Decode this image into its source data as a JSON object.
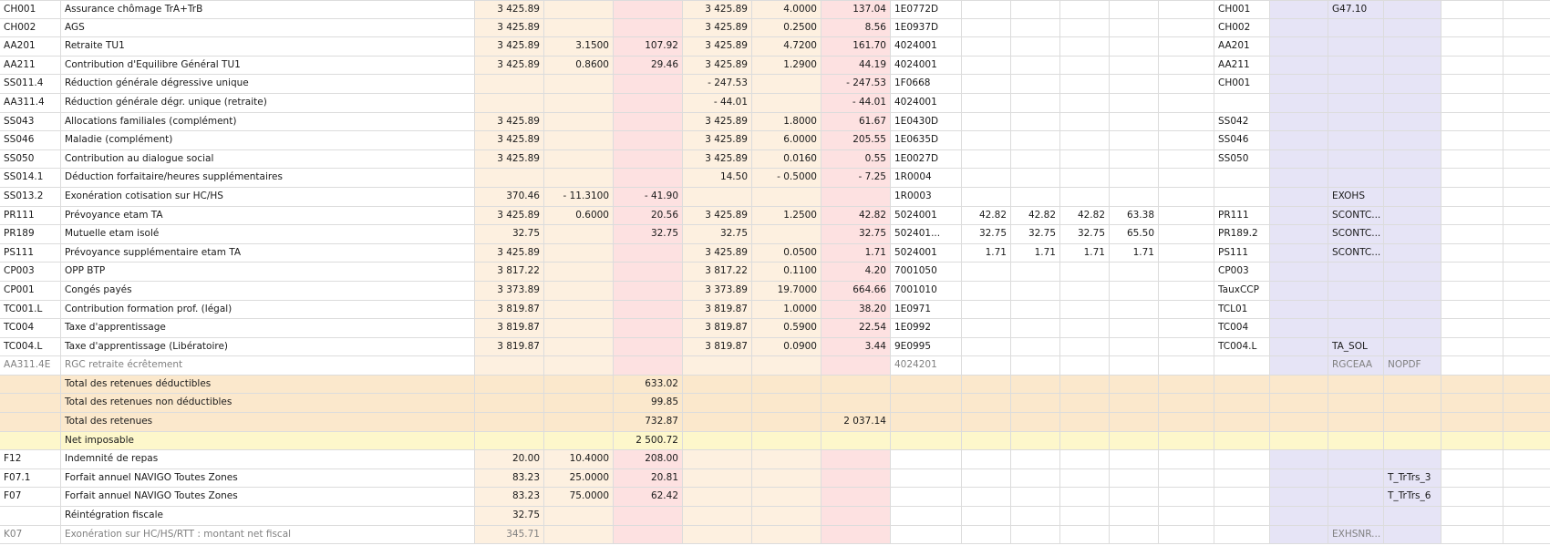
{
  "rows": [
    {
      "kind": "normal",
      "cells": [
        "CH001",
        "Assurance chômage TrA+TrB",
        "3 425.89",
        "",
        "",
        "3 425.89",
        "4.0000",
        "137.04",
        "1E0772D",
        "",
        "",
        "",
        "",
        "",
        "CH001",
        "",
        "G47.10",
        "",
        "",
        ""
      ]
    },
    {
      "kind": "normal",
      "cells": [
        "CH002",
        "AGS",
        "3 425.89",
        "",
        "",
        "3 425.89",
        "0.2500",
        "8.56",
        "1E0937D",
        "",
        "",
        "",
        "",
        "",
        "CH002",
        "",
        "",
        "",
        "",
        ""
      ]
    },
    {
      "kind": "normal",
      "cells": [
        "AA201",
        "Retraite TU1",
        "3 425.89",
        "3.1500",
        "107.92",
        "3 425.89",
        "4.7200",
        "161.70",
        "4024001",
        "",
        "",
        "",
        "",
        "",
        "AA201",
        "",
        "",
        "",
        "",
        ""
      ]
    },
    {
      "kind": "normal",
      "cells": [
        "AA211",
        "Contribution d'Equilibre Général TU1",
        "3 425.89",
        "0.8600",
        "29.46",
        "3 425.89",
        "1.2900",
        "44.19",
        "4024001",
        "",
        "",
        "",
        "",
        "",
        "AA211",
        "",
        "",
        "",
        "",
        ""
      ]
    },
    {
      "kind": "normal",
      "cells": [
        "SS011.4",
        "Réduction générale dégressive unique",
        "",
        "",
        "",
        "- 247.53",
        "",
        "- 247.53",
        "1F0668",
        "",
        "",
        "",
        "",
        "",
        "CH001",
        "",
        "",
        "",
        "",
        ""
      ]
    },
    {
      "kind": "normal",
      "cells": [
        "AA311.4",
        "Réduction générale dégr. unique (retraite)",
        "",
        "",
        "",
        "- 44.01",
        "",
        "- 44.01",
        "4024001",
        "",
        "",
        "",
        "",
        "",
        "",
        "",
        "",
        "",
        "",
        ""
      ]
    },
    {
      "kind": "normal",
      "cells": [
        "SS043",
        "Allocations familiales (complément)",
        "3 425.89",
        "",
        "",
        "3 425.89",
        "1.8000",
        "61.67",
        "1E0430D",
        "",
        "",
        "",
        "",
        "",
        "SS042",
        "",
        "",
        "",
        "",
        ""
      ]
    },
    {
      "kind": "normal",
      "cells": [
        "SS046",
        "Maladie (complément)",
        "3 425.89",
        "",
        "",
        "3 425.89",
        "6.0000",
        "205.55",
        "1E0635D",
        "",
        "",
        "",
        "",
        "",
        "SS046",
        "",
        "",
        "",
        "",
        ""
      ]
    },
    {
      "kind": "normal",
      "cells": [
        "SS050",
        "Contribution au dialogue social",
        "3 425.89",
        "",
        "",
        "3 425.89",
        "0.0160",
        "0.55",
        "1E0027D",
        "",
        "",
        "",
        "",
        "",
        "SS050",
        "",
        "",
        "",
        "",
        ""
      ]
    },
    {
      "kind": "normal",
      "cells": [
        "SS014.1",
        "Déduction forfaitaire/heures supplémentaires",
        "",
        "",
        "",
        "14.50",
        "- 0.5000",
        "- 7.25",
        "1R0004",
        "",
        "",
        "",
        "",
        "",
        "",
        "",
        "",
        "",
        "",
        ""
      ]
    },
    {
      "kind": "normal",
      "cells": [
        "SS013.2",
        "Exonération cotisation sur HC/HS",
        "370.46",
        "- 11.3100",
        "- 41.90",
        "",
        "",
        "",
        "1R0003",
        "",
        "",
        "",
        "",
        "",
        "",
        "",
        "EXOHS",
        "",
        "",
        ""
      ]
    },
    {
      "kind": "normal",
      "cells": [
        "PR111",
        "Prévoyance etam TA",
        "3 425.89",
        "0.6000",
        "20.56",
        "3 425.89",
        "1.2500",
        "42.82",
        "5024001",
        "42.82",
        "42.82",
        "42.82",
        "63.38",
        "",
        "PR111",
        "",
        "SCONTC...",
        "",
        "",
        ""
      ]
    },
    {
      "kind": "normal",
      "cells": [
        "PR189",
        "Mutuelle etam isolé",
        "32.75",
        "",
        "32.75",
        "32.75",
        "",
        "32.75",
        "502401...",
        "32.75",
        "32.75",
        "32.75",
        "65.50",
        "",
        "PR189.2",
        "",
        "SCONTC...",
        "",
        "",
        ""
      ]
    },
    {
      "kind": "normal",
      "cells": [
        "PS111",
        "Prévoyance supplémentaire etam TA",
        "3 425.89",
        "",
        "",
        "3 425.89",
        "0.0500",
        "1.71",
        "5024001",
        "1.71",
        "1.71",
        "1.71",
        "1.71",
        "",
        "PS111",
        "",
        "SCONTC...",
        "",
        "",
        ""
      ]
    },
    {
      "kind": "normal",
      "cells": [
        "CP003",
        "OPP BTP",
        "3 817.22",
        "",
        "",
        "3 817.22",
        "0.1100",
        "4.20",
        "7001050",
        "",
        "",
        "",
        "",
        "",
        "CP003",
        "",
        "",
        "",
        "",
        ""
      ]
    },
    {
      "kind": "normal",
      "cells": [
        "CP001",
        "Congés payés",
        "3 373.89",
        "",
        "",
        "3 373.89",
        "19.7000",
        "664.66",
        "7001010",
        "",
        "",
        "",
        "",
        "",
        "TauxCCP",
        "",
        "",
        "",
        "",
        ""
      ]
    },
    {
      "kind": "normal",
      "cells": [
        "TC001.L",
        "Contribution formation prof. (légal)",
        "3 819.87",
        "",
        "",
        "3 819.87",
        "1.0000",
        "38.20",
        "1E0971",
        "",
        "",
        "",
        "",
        "",
        "TCL01",
        "",
        "",
        "",
        "",
        ""
      ]
    },
    {
      "kind": "normal",
      "cells": [
        "TC004",
        "Taxe d'apprentissage",
        "3 819.87",
        "",
        "",
        "3 819.87",
        "0.5900",
        "22.54",
        "1E0992",
        "",
        "",
        "",
        "",
        "",
        "TC004",
        "",
        "",
        "",
        "",
        ""
      ]
    },
    {
      "kind": "normal",
      "cells": [
        "TC004.L",
        "Taxe d'apprentissage (Libératoire)",
        "3 819.87",
        "",
        "",
        "3 819.87",
        "0.0900",
        "3.44",
        "9E0995",
        "",
        "",
        "",
        "",
        "",
        "TC004.L",
        "",
        "TA_SOL",
        "",
        "",
        ""
      ]
    },
    {
      "kind": "grey",
      "cells": [
        "AA311.4E",
        "RGC retraite écrêtement",
        "",
        "",
        "",
        "",
        "",
        "",
        "4024201",
        "",
        "",
        "",
        "",
        "",
        "",
        "",
        "RGCEAA",
        "NOPDF",
        "",
        ""
      ]
    },
    {
      "kind": "total",
      "cells": [
        "",
        "Total des retenues déductibles",
        "",
        "",
        "633.02",
        "",
        "",
        "",
        "",
        "",
        "",
        "",
        "",
        "",
        "",
        "",
        "",
        "",
        "",
        ""
      ]
    },
    {
      "kind": "total",
      "cells": [
        "",
        "Total des retenues non déductibles",
        "",
        "",
        "99.85",
        "",
        "",
        "",
        "",
        "",
        "",
        "",
        "",
        "",
        "",
        "",
        "",
        "",
        "",
        ""
      ]
    },
    {
      "kind": "total",
      "cells": [
        "",
        "Total des retenues",
        "",
        "",
        "732.87",
        "",
        "",
        "2 037.14",
        "",
        "",
        "",
        "",
        "",
        "",
        "",
        "",
        "",
        "",
        "",
        ""
      ]
    },
    {
      "kind": "netimp",
      "cells": [
        "",
        "Net imposable",
        "",
        "",
        "2 500.72",
        "",
        "",
        "",
        "",
        "",
        "",
        "",
        "",
        "",
        "",
        "",
        "",
        "",
        "",
        ""
      ]
    },
    {
      "kind": "normal",
      "cells": [
        "F12",
        "Indemnité de repas",
        "20.00",
        "10.4000",
        "208.00",
        "",
        "",
        "",
        "",
        "",
        "",
        "",
        "",
        "",
        "",
        "",
        "",
        "",
        "",
        ""
      ]
    },
    {
      "kind": "normal",
      "cells": [
        "F07.1",
        "Forfait annuel NAVIGO Toutes Zones",
        "83.23",
        "25.0000",
        "20.81",
        "",
        "",
        "",
        "",
        "",
        "",
        "",
        "",
        "",
        "",
        "",
        "",
        "T_TrTrs_3",
        "",
        ""
      ]
    },
    {
      "kind": "normal",
      "cells": [
        "F07",
        "Forfait annuel NAVIGO Toutes Zones",
        "83.23",
        "75.0000",
        "62.42",
        "",
        "",
        "",
        "",
        "",
        "",
        "",
        "",
        "",
        "",
        "",
        "",
        "T_TrTrs_6",
        "",
        ""
      ]
    },
    {
      "kind": "normal",
      "cells": [
        "",
        "Réintégration fiscale",
        "32.75",
        "",
        "",
        "",
        "",
        "",
        "",
        "",
        "",
        "",
        "",
        "",
        "",
        "",
        "",
        "",
        "",
        ""
      ]
    },
    {
      "kind": "grey",
      "cells": [
        "K07",
        "Exonération sur HC/HS/RTT : montant net fiscal",
        "345.71",
        "",
        "",
        "",
        "",
        "",
        "",
        "",
        "",
        "",
        "",
        "",
        "",
        "",
        "EXHSNR...",
        "",
        "",
        ""
      ]
    }
  ]
}
